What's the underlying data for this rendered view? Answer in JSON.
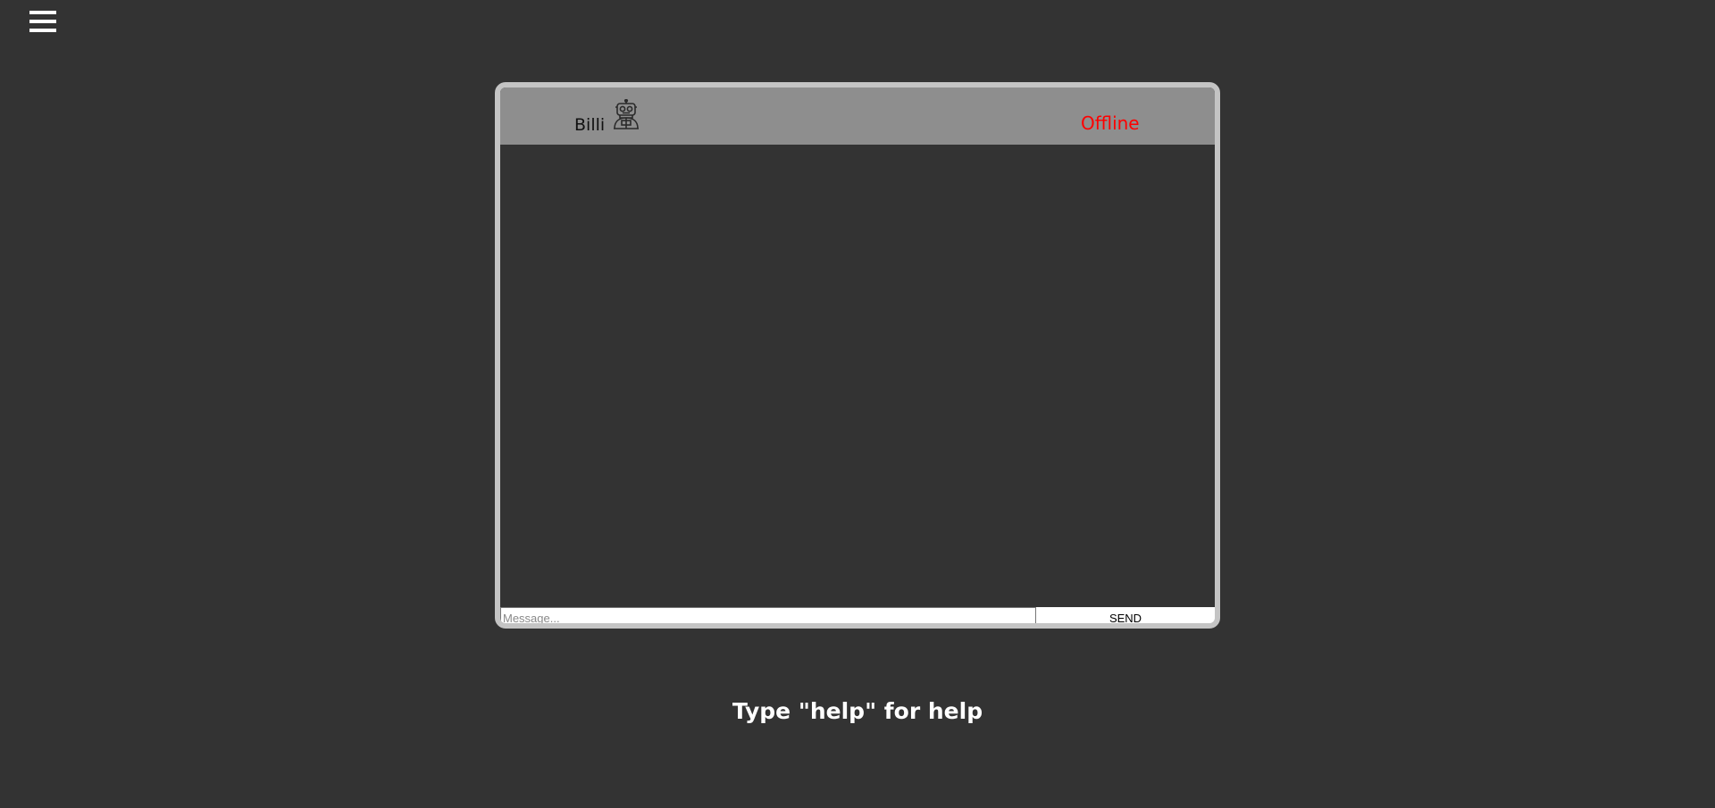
{
  "menu": {
    "icon": "hamburger-menu-icon"
  },
  "chat": {
    "bot_name": "Billi",
    "avatar_icon": "robot-icon",
    "status": "Offline",
    "status_color": "#ff0000",
    "input": {
      "value": "",
      "placeholder": "Message..."
    },
    "send_label": "SEND"
  },
  "footer": {
    "help_text": "Type \"help\" for help"
  },
  "colors": {
    "background": "#333333",
    "header": "#8e8e8e",
    "frame": "#c4c4c4"
  }
}
